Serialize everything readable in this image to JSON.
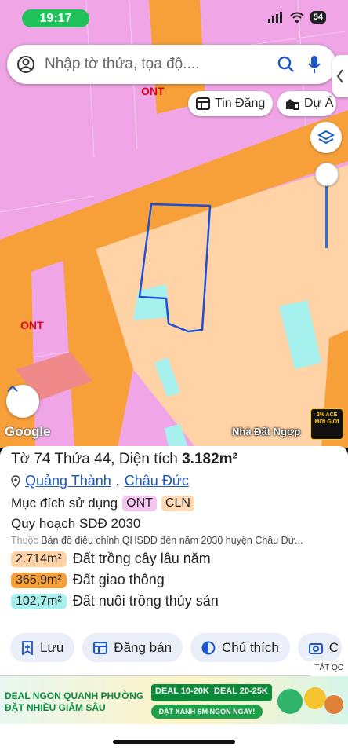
{
  "status_bar": {
    "time": "19:17",
    "battery": "54"
  },
  "search": {
    "placeholder": "Nhập tờ thửa, tọa độ...."
  },
  "chips": [
    {
      "label": "Tin Đăng"
    },
    {
      "label": "Dự Á"
    }
  ],
  "map": {
    "labels": [
      "ONT",
      "ONT"
    ],
    "google": "Google",
    "brand": "Nhà Đất Ngợp",
    "promo": [
      "2% ACE",
      "MỜI GIỚI"
    ]
  },
  "parcel": {
    "title_prefix": "Tờ 74 Thửa 44, Diện tích ",
    "area": "3.182m²",
    "ward": "Quảng Thành",
    "district": "Châu Đức",
    "purpose_label": "Mục đích sử dụng",
    "purpose_codes": [
      "ONT",
      "CLN"
    ],
    "plan_label": "Quy hoạch SDĐ 2030",
    "source_prefix": "Thuộc",
    "source_text": "Bản đồ điều chỉnh QHSDĐ đến năm 2030 huyện Châu Đứ...",
    "areas": [
      {
        "value": "2.714m²",
        "label": "Đất trồng cây lâu năm",
        "color": "#ffd3a6"
      },
      {
        "value": "365,9m²",
        "label": "Đất giao thông",
        "color": "#f7a03a"
      },
      {
        "value": "102,7m²",
        "label": "Đất nuôi trồng thủy sản",
        "color": "#a6f0ee"
      }
    ],
    "actions": [
      "Lưu",
      "Đăng bán",
      "Chú thích",
      "C"
    ]
  },
  "ad": {
    "close": "TẮT QC",
    "headline_1": "DEAL NGON QUANH PHƯỜNG",
    "headline_2": "ĐẶT NHIỀU GIẢM SÂU",
    "deal_1": "DEAL 10-20K",
    "deal_2": "DEAL 20-25K",
    "cta": "ĐẶT XANH SM NGON NGAY!"
  },
  "colors": {
    "residential": "#f0a6e6",
    "perennial": "#ffd3a6",
    "road": "#f7a03a",
    "aquaculture": "#a6f0ee",
    "link": "#1a56c7"
  }
}
